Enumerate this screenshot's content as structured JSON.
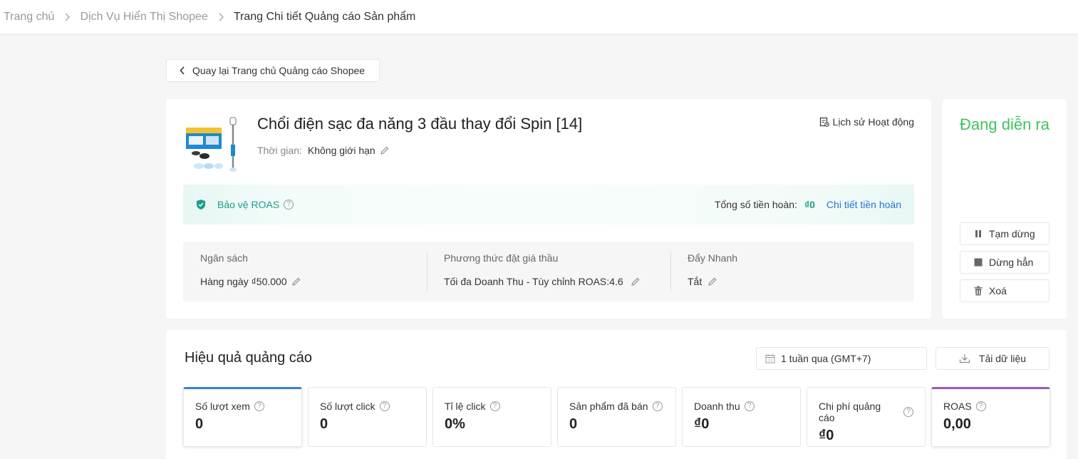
{
  "breadcrumb": {
    "items": [
      "Trang chủ",
      "Dịch Vụ Hiển Thị Shopee",
      "Trang Chi tiết Quảng cáo Sản phẩm"
    ]
  },
  "back_button": {
    "label": "Quay lại Trang chủ Quảng cáo Shopee"
  },
  "ad": {
    "title": "Chổi điện sạc đa năng 3 đầu thay đổi Spin [14]",
    "time_label": "Thời gian:",
    "time_value": "Không giới hạn",
    "history_label": "Lịch sử Hoạt động",
    "roas": {
      "label": "Bảo vệ ROAS",
      "total_label": "Tổng số tiền hoàn:",
      "total_value": "₫0",
      "detail_link": "Chi tiết tiền hoàn"
    },
    "settings": [
      {
        "label": "Ngân sách",
        "value": "Hàng ngày ₫50.000"
      },
      {
        "label": "Phương thức đặt giá thầu",
        "value": "Tối đa Doanh Thu - Tùy chỉnh ROAS:4.6"
      },
      {
        "label": "Đẩy Nhanh",
        "value": "Tắt"
      }
    ]
  },
  "status": {
    "text": "Đang diễn ra",
    "color": "#3fc35f",
    "actions": {
      "pause": "Tạm dừng",
      "stop": "Dừng hẳn",
      "delete": "Xoá"
    }
  },
  "performance": {
    "title": "Hiệu quả quảng cáo",
    "date_range": "1 tuần qua (GMT+7)",
    "download_label": "Tải dữ liệu",
    "metrics": [
      {
        "label": "Số lượt xem",
        "value": "0"
      },
      {
        "label": "Số lượt click",
        "value": "0"
      },
      {
        "label": "Tỉ lệ click",
        "value": "0%"
      },
      {
        "label": "Sản phẩm đã bán",
        "value": "0"
      },
      {
        "label": "Doanh thu",
        "value": "₫0"
      },
      {
        "label": "Chi phí quảng cáo",
        "value": "₫0"
      },
      {
        "label": "ROAS",
        "value": "0,00"
      }
    ]
  },
  "colors": {
    "accent_teal": "#1a9e8a",
    "link_blue": "#2673dd",
    "metric_blue": "#3a7fd5",
    "metric_purple": "#9b59b6"
  }
}
